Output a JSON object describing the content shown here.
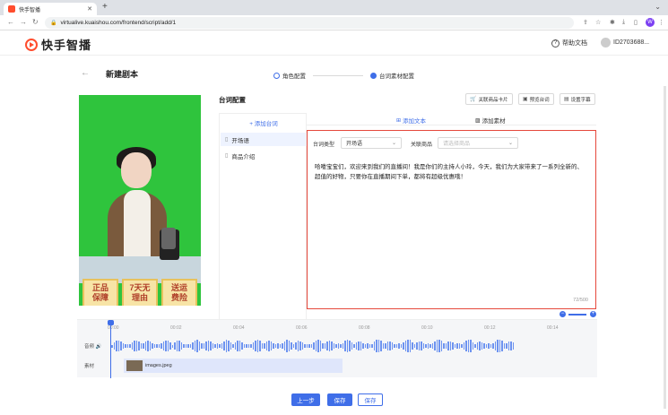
{
  "browser": {
    "tab_title": "快手智播",
    "url": "virtualive.kuaishou.com/frontend/script/add/1",
    "profile_initial": "W"
  },
  "header": {
    "brand": "快手智播",
    "help": "帮助文档",
    "user_id": "ID2703688..."
  },
  "page": {
    "title": "新建剧本",
    "steps": [
      {
        "label": "角色配置",
        "active": false
      },
      {
        "label": "台词素材配置",
        "active": true
      }
    ]
  },
  "preview": {
    "badges": [
      "正品\n保障",
      "7天无\n理由",
      "送运\n费险"
    ]
  },
  "config": {
    "title": "台词配置",
    "buttons": [
      "关联商品卡片",
      "预览台词",
      "设置字幕"
    ],
    "add_script": "+ 添加台词",
    "scripts": [
      {
        "label": "开场语",
        "selected": true
      },
      {
        "label": "商品介绍",
        "selected": false
      }
    ],
    "tabs": [
      "添加文本",
      "添加素材"
    ]
  },
  "editor": {
    "type_label": "台词类型",
    "type_value": "开场语",
    "product_label": "关联商品",
    "product_placeholder": "请选择商品",
    "text": "哈喽宝宝们，欢迎来到我们的直播间！我是你们的主持人小玲，今天，我们为大家带来了一系列全新的、超值的好物，只要你在直播期间下单，都将有超级优惠哦！",
    "counter": "72/500"
  },
  "timeline": {
    "ticks": [
      "00:00",
      "00:02",
      "00:04",
      "00:06",
      "00:08",
      "00:10",
      "00:12",
      "00:14"
    ],
    "audio_label": "音频",
    "material_label": "素材",
    "material_file": "images.jpeg"
  },
  "footer": {
    "prev": "上一步",
    "save": "保存",
    "save2": "保存"
  }
}
